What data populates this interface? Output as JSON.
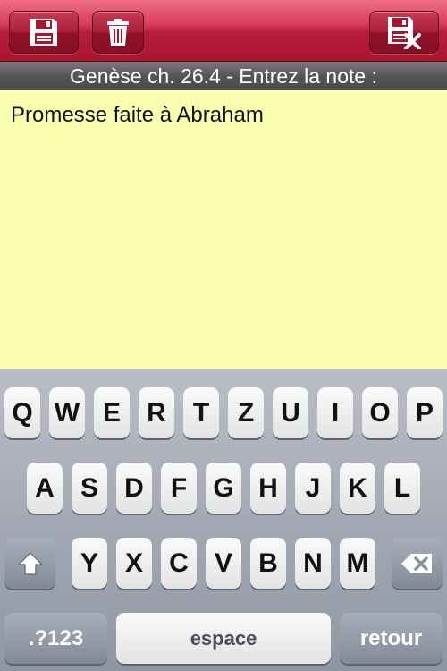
{
  "toolbar": {
    "save_icon": "floppy-disk-icon",
    "delete_icon": "trash-icon",
    "cancel_icon": "floppy-disk-cancel-icon",
    "color": "#c0283f"
  },
  "header": {
    "title": "Genèse ch. 26.4 - Entrez la note :"
  },
  "note": {
    "text": "Promesse faite à Abraham",
    "background": "#fbffb0"
  },
  "keyboard": {
    "row1": [
      "Q",
      "W",
      "E",
      "R",
      "T",
      "Z",
      "U",
      "I",
      "O",
      "P"
    ],
    "row2": [
      "A",
      "S",
      "D",
      "F",
      "G",
      "H",
      "J",
      "K",
      "L"
    ],
    "row3": [
      "Y",
      "X",
      "C",
      "V",
      "B",
      "N",
      "M"
    ],
    "shift_icon": "shift-arrow-icon",
    "backspace_icon": "backspace-icon",
    "numbers_label": ".?123",
    "space_label": "espace",
    "return_label": "retour"
  }
}
